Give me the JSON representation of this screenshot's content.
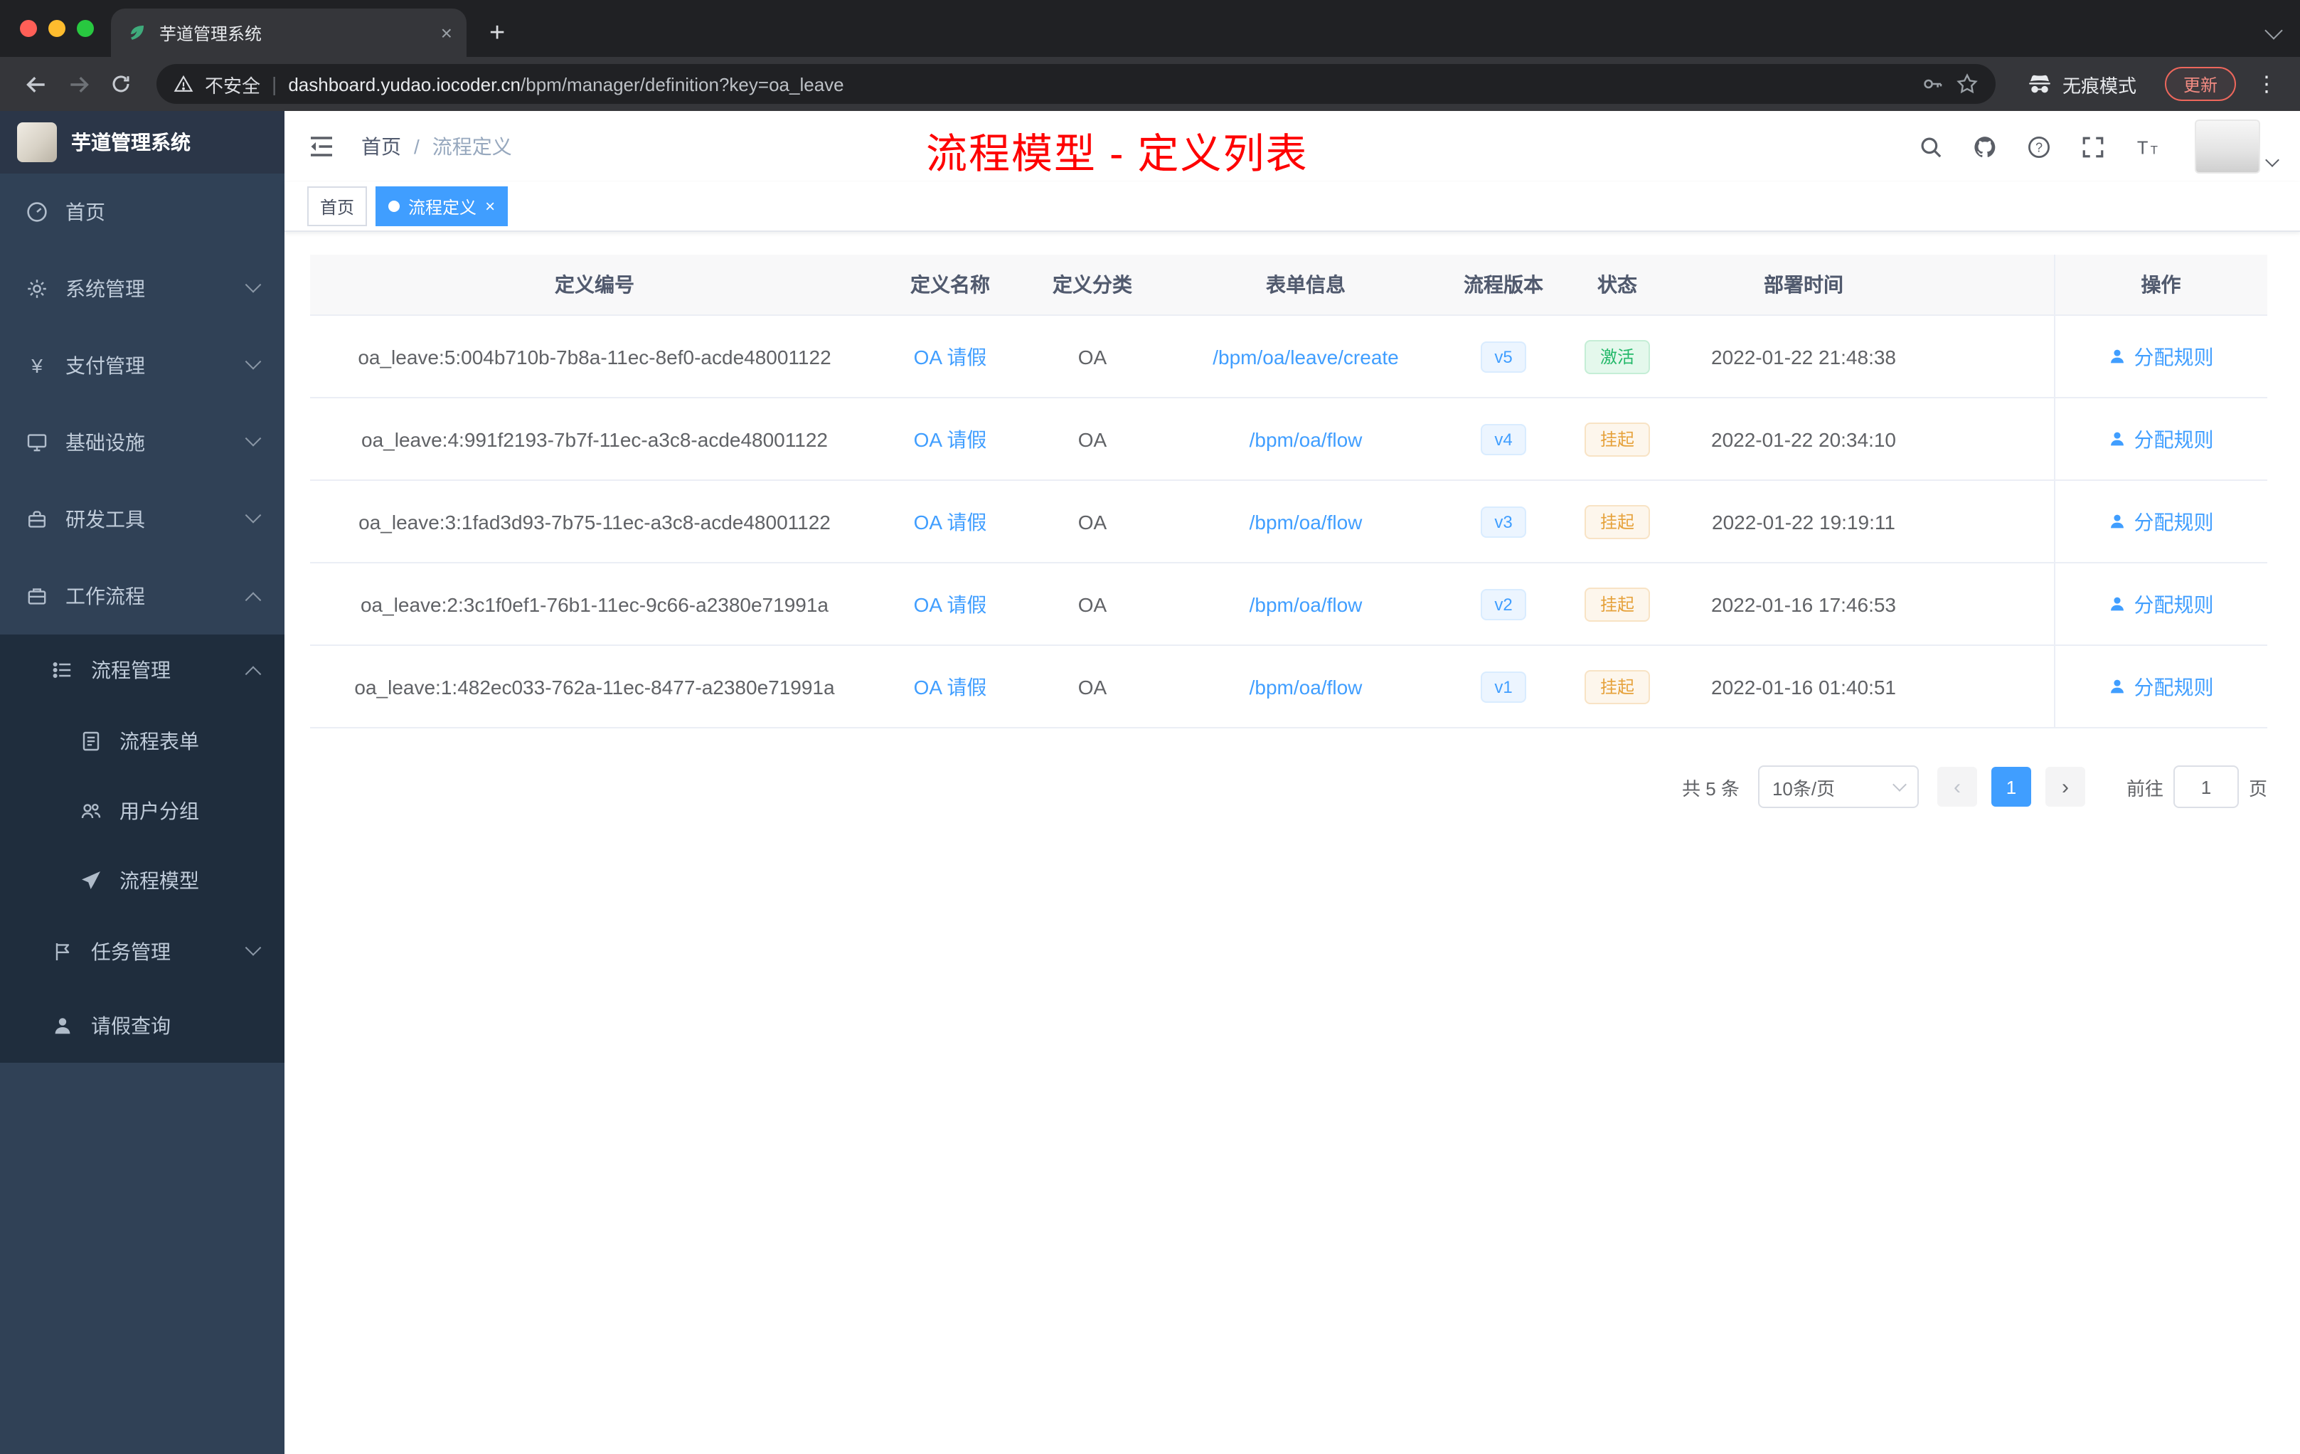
{
  "browser": {
    "tab_title": "芋道管理系统",
    "security_label": "不安全",
    "url_host": "dashboard.yudao.iocoder.cn",
    "url_path": "/bpm/manager/definition?key=oa_leave",
    "incognito_label": "无痕模式",
    "update_label": "更新"
  },
  "icons": {
    "tab_favicon": "green-leaf",
    "omnibox_left": "warning-triangle",
    "omnibox_right": [
      "key-icon",
      "star-icon"
    ],
    "navbar_right": [
      "search-icon",
      "github-icon",
      "question-icon",
      "fullscreen-icon",
      "font-size-icon"
    ]
  },
  "sidebar": {
    "logo_title": "芋道管理系统",
    "items": [
      {
        "label": "首页",
        "icon": "dashboard-icon"
      },
      {
        "label": "系统管理",
        "icon": "gear-icon",
        "expandable": true
      },
      {
        "label": "支付管理",
        "icon": "yen-icon",
        "expandable": true
      },
      {
        "label": "基础设施",
        "icon": "monitor-icon",
        "expandable": true
      },
      {
        "label": "研发工具",
        "icon": "toolbox-icon",
        "expandable": true
      },
      {
        "label": "工作流程",
        "icon": "briefcase-icon",
        "expanded": true
      },
      {
        "label": "流程管理",
        "icon": "list-icon",
        "expanded": true
      },
      {
        "label": "流程表单",
        "icon": "document-icon"
      },
      {
        "label": "用户分组",
        "icon": "users-icon"
      },
      {
        "label": "流程模型",
        "icon": "paper-plane-icon"
      },
      {
        "label": "任务管理",
        "icon": "flag-icon",
        "expandable": true
      },
      {
        "label": "请假查询",
        "icon": "person-icon"
      }
    ]
  },
  "header": {
    "breadcrumb_home": "首页",
    "breadcrumb_sep": "/",
    "breadcrumb_current": "流程定义",
    "annotation": "流程模型 - 定义列表"
  },
  "tags": {
    "home": "首页",
    "active": "流程定义",
    "active_close": "×"
  },
  "table": {
    "columns": [
      "定义编号",
      "定义名称",
      "定义分类",
      "表单信息",
      "流程版本",
      "状态",
      "部署时间",
      "操作"
    ],
    "rows": [
      {
        "id": "oa_leave:5:004b710b-7b8a-11ec-8ef0-acde48001122",
        "name": "OA 请假",
        "category": "OA",
        "form": "/bpm/oa/leave/create",
        "version": "v5",
        "status": "激活",
        "status_type": "success",
        "time": "2022-01-22 21:48:38",
        "action": "分配规则"
      },
      {
        "id": "oa_leave:4:991f2193-7b7f-11ec-a3c8-acde48001122",
        "name": "OA 请假",
        "category": "OA",
        "form": "/bpm/oa/flow",
        "version": "v4",
        "status": "挂起",
        "status_type": "warning",
        "time": "2022-01-22 20:34:10",
        "action": "分配规则"
      },
      {
        "id": "oa_leave:3:1fad3d93-7b75-11ec-a3c8-acde48001122",
        "name": "OA 请假",
        "category": "OA",
        "form": "/bpm/oa/flow",
        "version": "v3",
        "status": "挂起",
        "status_type": "warning",
        "time": "2022-01-22 19:19:11",
        "action": "分配规则"
      },
      {
        "id": "oa_leave:2:3c1f0ef1-76b1-11ec-9c66-a2380e71991a",
        "name": "OA 请假",
        "category": "OA",
        "form": "/bpm/oa/flow",
        "version": "v2",
        "status": "挂起",
        "status_type": "warning",
        "time": "2022-01-16 17:46:53",
        "action": "分配规则"
      },
      {
        "id": "oa_leave:1:482ec033-762a-11ec-8477-a2380e71991a",
        "name": "OA 请假",
        "category": "OA",
        "form": "/bpm/oa/flow",
        "version": "v1",
        "status": "挂起",
        "status_type": "warning",
        "time": "2022-01-16 01:40:51",
        "action": "分配规则"
      }
    ]
  },
  "pagination": {
    "total": "共 5 条",
    "page_size": "10条/页",
    "prev": "‹",
    "current_page": "1",
    "next": "›",
    "goto_label": "前往",
    "goto_value": "1",
    "goto_suffix": "页"
  },
  "colors": {
    "accent": "#409eff",
    "success": "#23b869",
    "warning": "#e6a23c",
    "annotation_red": "#fe0000",
    "sidebar_bg": "#304156",
    "submenu_bg": "#1f2d3d"
  }
}
